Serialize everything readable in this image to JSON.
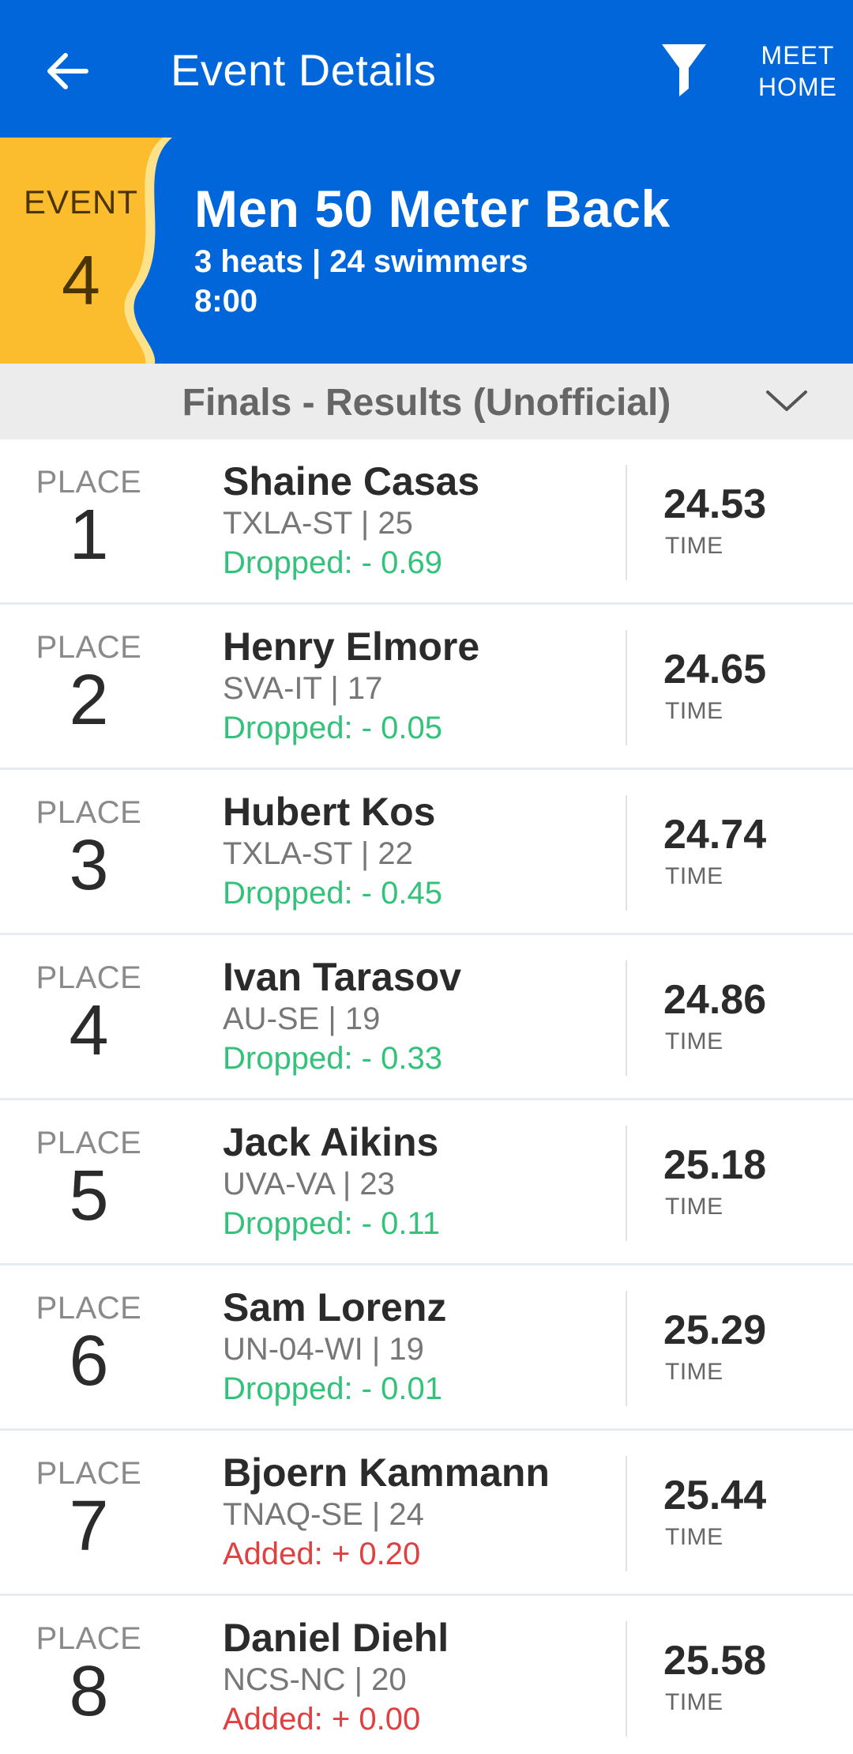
{
  "header": {
    "title": "Event Details",
    "back_icon": "arrow-left-icon",
    "filter_icon": "filter-icon",
    "meet_home_line1": "MEET",
    "meet_home_line2": "HOME"
  },
  "event": {
    "label": "EVENT",
    "number": "4",
    "name": "Men 50 Meter Back",
    "summary": "3 heats | 24 swimmers",
    "time": "8:00"
  },
  "round": {
    "label": "Finals - Results (Unofficial)",
    "chevron_icon": "chevron-down-icon"
  },
  "results": [
    {
      "place_label": "PLACE",
      "place": "1",
      "name": "Shaine Casas",
      "team_age": "TXLA-ST | 25",
      "delta": "Dropped: - 0.69",
      "delta_type": "dropped",
      "time": "24.53",
      "time_label": "TIME"
    },
    {
      "place_label": "PLACE",
      "place": "2",
      "name": "Henry Elmore",
      "team_age": "SVA-IT | 17",
      "delta": "Dropped: - 0.05",
      "delta_type": "dropped",
      "time": "24.65",
      "time_label": "TIME"
    },
    {
      "place_label": "PLACE",
      "place": "3",
      "name": "Hubert Kos",
      "team_age": "TXLA-ST | 22",
      "delta": "Dropped: - 0.45",
      "delta_type": "dropped",
      "time": "24.74",
      "time_label": "TIME"
    },
    {
      "place_label": "PLACE",
      "place": "4",
      "name": "Ivan Tarasov",
      "team_age": "AU-SE | 19",
      "delta": "Dropped: - 0.33",
      "delta_type": "dropped",
      "time": "24.86",
      "time_label": "TIME"
    },
    {
      "place_label": "PLACE",
      "place": "5",
      "name": "Jack Aikins",
      "team_age": "UVA-VA | 23",
      "delta": "Dropped: - 0.11",
      "delta_type": "dropped",
      "time": "25.18",
      "time_label": "TIME"
    },
    {
      "place_label": "PLACE",
      "place": "6",
      "name": "Sam Lorenz",
      "team_age": "UN-04-WI | 19",
      "delta": "Dropped: - 0.01",
      "delta_type": "dropped",
      "time": "25.29",
      "time_label": "TIME"
    },
    {
      "place_label": "PLACE",
      "place": "7",
      "name": "Bjoern Kammann",
      "team_age": "TNAQ-SE | 24",
      "delta": "Added: + 0.20",
      "delta_type": "added",
      "time": "25.44",
      "time_label": "TIME"
    },
    {
      "place_label": "PLACE",
      "place": "8",
      "name": "Daniel Diehl",
      "team_age": "NCS-NC | 20",
      "delta": "Added: + 0.00",
      "delta_type": "added",
      "time": "25.58",
      "time_label": "TIME"
    }
  ],
  "colors": {
    "brand_blue": "#0066d9",
    "event_gold": "#fbbd2e",
    "dropped_green": "#33c27a",
    "added_red": "#e04040"
  }
}
